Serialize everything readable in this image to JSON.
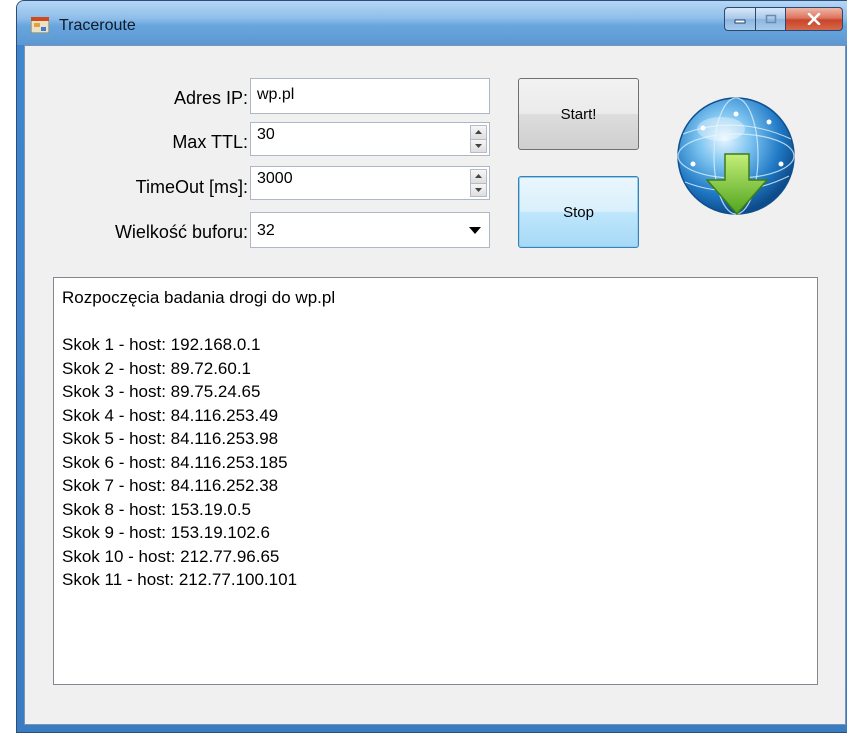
{
  "window": {
    "title": "Traceroute"
  },
  "form": {
    "ip_label": "Adres IP:",
    "ip_value": "wp.pl",
    "ttl_label": "Max TTL:",
    "ttl_value": "30",
    "timeout_label": "TimeOut [ms]:",
    "timeout_value": "3000",
    "buffer_label": "Wielkość buforu:",
    "buffer_value": "32"
  },
  "buttons": {
    "start": "Start!",
    "stop": "Stop"
  },
  "log": {
    "lines": [
      "Rozpoczęcia badania drogi do wp.pl",
      "",
      "Skok 1 - host: 192.168.0.1",
      "Skok 2 - host: 89.72.60.1",
      "Skok 3 - host: 89.75.24.65",
      "Skok 4 - host: 84.116.253.49",
      "Skok 5 - host: 84.116.253.98",
      "Skok 6 - host: 84.116.253.185",
      "Skok 7 - host: 84.116.252.38",
      "Skok 8 - host: 153.19.0.5",
      "Skok 9 - host: 153.19.102.6",
      "Skok 10 - host: 212.77.96.65",
      "Skok 11 - host: 212.77.100.101"
    ]
  },
  "icons": {
    "app": "form-icon",
    "logo": "globe-download-icon",
    "minimize": "minimize-icon",
    "maximize": "maximize-icon",
    "close": "close-icon"
  },
  "colors": {
    "titlebar": "#6aa6de",
    "close_button": "#c9442b",
    "focus_button": "#bee6fd",
    "client_bg": "#f0f0f0"
  }
}
